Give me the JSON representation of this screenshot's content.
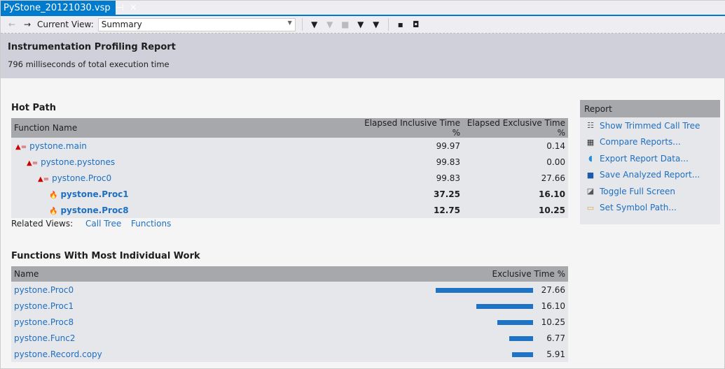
{
  "tab": {
    "title": "PyStone_20121030.vsp",
    "pin": "⊣",
    "close": "✕"
  },
  "toolbar": {
    "back": "←",
    "forward": "→",
    "current_view_label": "Current View:",
    "current_view": "Summary"
  },
  "header": {
    "title": "Instrumentation Profiling Report",
    "subtitle": "796 milliseconds of total execution time"
  },
  "hot_path": {
    "title": "Hot Path",
    "columns": [
      "Function Name",
      "Elapsed Inclusive Time %",
      "Elapsed Exclusive Time %"
    ],
    "rows": [
      {
        "name": "pystone.main",
        "inclusive": "99.97",
        "exclusive": "0.14",
        "bold": false,
        "indent": 0
      },
      {
        "name": "pystone.pystones",
        "inclusive": "99.83",
        "exclusive": "0.00",
        "bold": false,
        "indent": 1
      },
      {
        "name": "pystone.Proc0",
        "inclusive": "99.83",
        "exclusive": "27.66",
        "bold": false,
        "indent": 2
      },
      {
        "name": "pystone.Proc1",
        "inclusive": "37.25",
        "exclusive": "16.10",
        "bold": true,
        "indent": 3
      },
      {
        "name": "pystone.Proc8",
        "inclusive": "12.75",
        "exclusive": "10.25",
        "bold": true,
        "indent": 3
      }
    ],
    "related_label": "Related Views:",
    "related": [
      "Call Tree",
      "Functions"
    ]
  },
  "work": {
    "title": "Functions With Most Individual Work",
    "columns": [
      "Name",
      "Exclusive Time %"
    ],
    "rows": [
      {
        "name": "pystone.Proc0",
        "value": 27.66,
        "label": "27.66"
      },
      {
        "name": "pystone.Proc1",
        "value": 16.1,
        "label": "16.10"
      },
      {
        "name": "pystone.Proc8",
        "value": 10.25,
        "label": "10.25"
      },
      {
        "name": "pystone.Func2",
        "value": 6.77,
        "label": "6.77"
      },
      {
        "name": "pystone.Record.copy",
        "value": 5.91,
        "label": "5.91"
      }
    ]
  },
  "report": {
    "title": "Report",
    "items": [
      "Show Trimmed Call Tree",
      "Compare Reports...",
      "Export Report Data...",
      "Save Analyzed Report...",
      "Toggle Full Screen",
      "Set Symbol Path..."
    ]
  },
  "colors": {
    "accent": "#007acc",
    "link": "#1e6fc0",
    "bar": "#1e73c4"
  }
}
